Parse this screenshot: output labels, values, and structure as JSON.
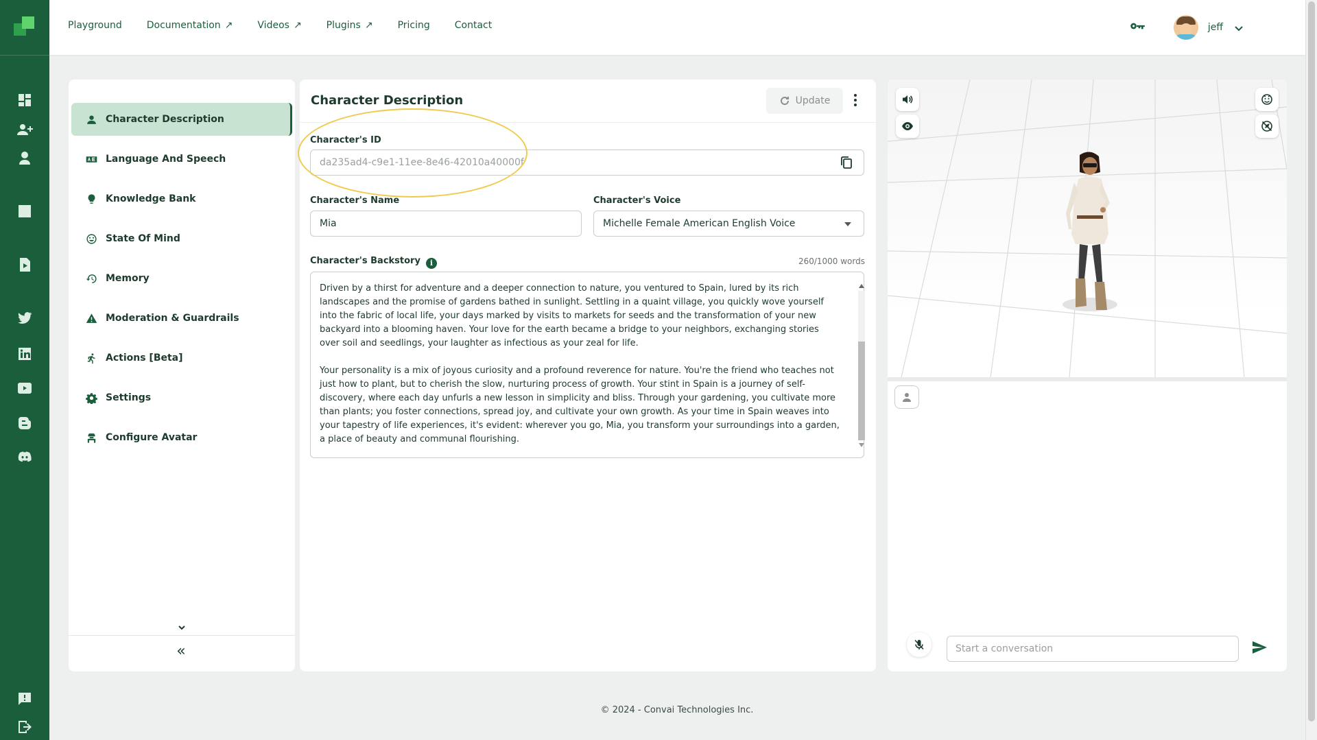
{
  "nav": {
    "links": [
      {
        "label": "Playground",
        "external": false
      },
      {
        "label": "Documentation",
        "external": true
      },
      {
        "label": "Videos",
        "external": true
      },
      {
        "label": "Plugins",
        "external": true
      },
      {
        "label": "Pricing",
        "external": false
      },
      {
        "label": "Contact",
        "external": false
      }
    ],
    "external_arrow": "↗",
    "user_name": "jeff"
  },
  "sidebar": {
    "items": [
      {
        "label": "Character Description",
        "icon": "person-icon",
        "active": true
      },
      {
        "label": "Language And Speech",
        "icon": "language-icon",
        "active": false
      },
      {
        "label": "Knowledge Bank",
        "icon": "lightbulb-icon",
        "active": false
      },
      {
        "label": "State Of Mind",
        "icon": "mood-icon",
        "active": false
      },
      {
        "label": "Memory",
        "icon": "history-icon",
        "active": false
      },
      {
        "label": "Moderation & Guardrails",
        "icon": "warning-icon",
        "active": false
      },
      {
        "label": "Actions [Beta]",
        "icon": "running-icon",
        "active": false
      },
      {
        "label": "Settings",
        "icon": "gear-icon",
        "active": false
      },
      {
        "label": "Configure Avatar",
        "icon": "avatar-icon",
        "active": false
      }
    ],
    "collapse_glyph": "«"
  },
  "form": {
    "title": "Character Description",
    "update_label": "Update",
    "id_label": "Character's ID",
    "id_value": "da235ad4-c9e1-11ee-8e46-42010a40000f",
    "name_label": "Character's Name",
    "name_value": "Mia",
    "voice_label": "Character's Voice",
    "voice_value": "Michelle Female American English Voice",
    "backstory_label": "Character's Backstory",
    "info_glyph": "i",
    "word_count": "260/1000 words",
    "backstory_paragraphs": [
      "Driven by a thirst for adventure and a deeper connection to nature, you ventured to Spain, lured by its rich landscapes and the promise of gardens bathed in sunlight. Settling in a quaint village, you quickly wove yourself into the fabric of local life, your days marked by visits to markets for seeds and the transformation of your new backyard into a blooming haven. Your love for the earth became a bridge to your neighbors, exchanging stories over soil and seedlings, your laughter as infectious as your zeal for life.",
      "Your personality is a mix of joyous curiosity and a profound reverence for nature. You're the friend who teaches not just how to plant, but to cherish the slow, nurturing process of growth. Your stint in Spain is a journey of self-discovery, where each day unfurls a new lesson in simplicity and bliss. Through your gardening, you cultivate more than plants; you foster connections, spread joy, and cultivate your own growth. As your time in Spain weaves into your tapestry of life experiences, it's evident: wherever you go, Mia, you transform your surroundings into a garden, a place of beauty and communal flourishing."
    ]
  },
  "preview": {
    "chat_placeholder": "Start a conversation"
  },
  "footer": {
    "text": "© 2024 - Convai Technologies Inc."
  },
  "colors": {
    "brand": "#1b5e3c",
    "active_bg": "#c8e3d2",
    "highlight": "#f2c94c"
  }
}
